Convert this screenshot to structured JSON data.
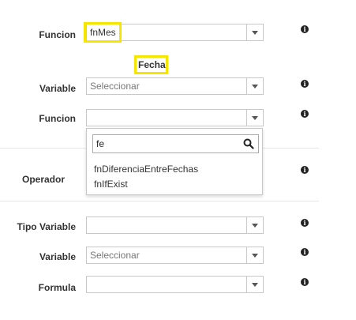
{
  "rows": {
    "funcion1": {
      "label": "Funcion",
      "value": "fnMes"
    },
    "section_heading": "Fecha",
    "variable1": {
      "label": "Variable",
      "placeholder": "Seleccionar"
    },
    "funcion2": {
      "label": "Funcion",
      "value": ""
    },
    "operador": {
      "label": "Operador"
    },
    "tipo_variable": {
      "label": "Tipo Variable",
      "value": ""
    },
    "variable2": {
      "label": "Variable",
      "placeholder": "Seleccionar"
    },
    "formula": {
      "label": "Formula",
      "value": ""
    }
  },
  "dropdown": {
    "search_value": "fe",
    "options": [
      "fnDiferenciaEntreFechas",
      "fnIfExist"
    ]
  },
  "icons": {
    "info": "info-icon",
    "search": "search-icon",
    "caret": "chevron-down-icon"
  },
  "colors": {
    "highlight": "#f5e500",
    "info_icon": "#222222",
    "border": "#c8c8c8"
  }
}
